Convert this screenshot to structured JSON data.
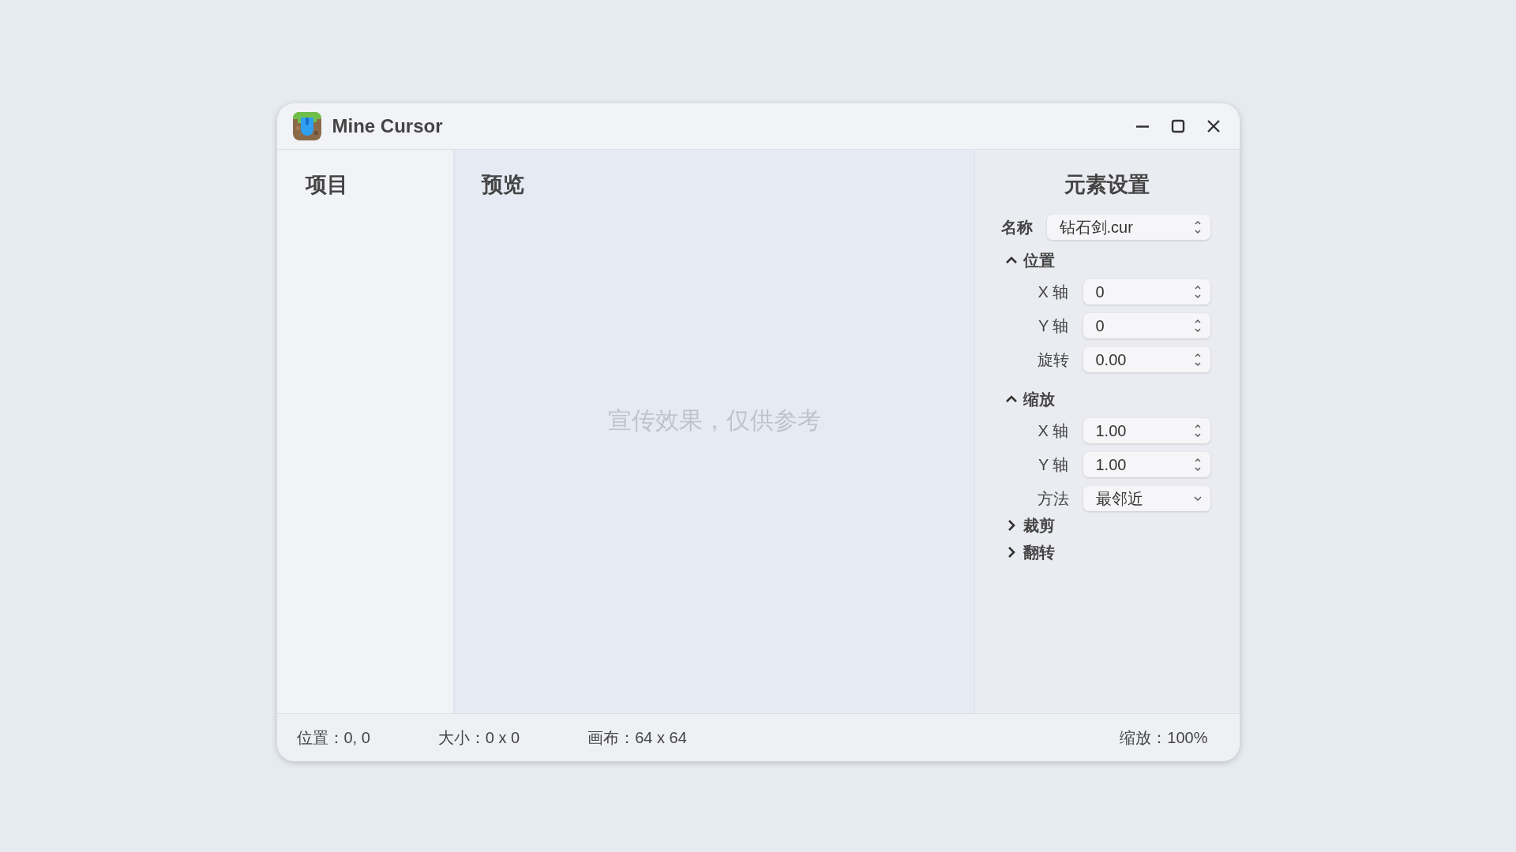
{
  "window": {
    "title": "Mine Cursor"
  },
  "project_panel": {
    "title": "项目"
  },
  "preview_panel": {
    "title": "预览",
    "note": "宣传效果，仅供参考"
  },
  "settings_panel": {
    "title": "元素设置",
    "name_field": {
      "label": "名称",
      "value": "钻石剑.cur"
    },
    "sections": [
      {
        "title": "位置",
        "expanded": true,
        "fields": [
          {
            "label": "X 轴",
            "value": "0",
            "kind": "spin"
          },
          {
            "label": "Y 轴",
            "value": "0",
            "kind": "spin"
          },
          {
            "label": "旋转",
            "value": "0.00",
            "kind": "spin"
          }
        ]
      },
      {
        "title": "缩放",
        "expanded": true,
        "fields": [
          {
            "label": "X 轴",
            "value": "1.00",
            "kind": "spin"
          },
          {
            "label": "Y 轴",
            "value": "1.00",
            "kind": "spin"
          },
          {
            "label": "方法",
            "value": "最邻近",
            "kind": "select"
          }
        ]
      },
      {
        "title": "裁剪",
        "expanded": false
      },
      {
        "title": "翻转",
        "expanded": false
      }
    ]
  },
  "status_bar": {
    "left": [
      "位置：0, 0",
      "大小：0 x 0",
      "画布：64 x 64"
    ],
    "right": "缩放：100%"
  }
}
